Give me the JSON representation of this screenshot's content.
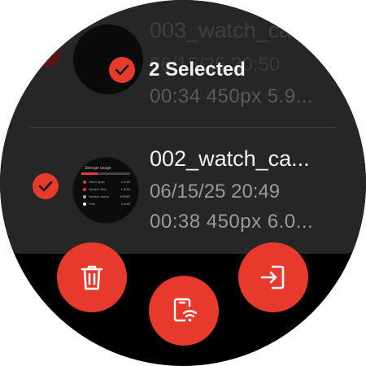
{
  "colors": {
    "accent": "#e8392d",
    "background": "#000000",
    "card": "#262626"
  },
  "ghost_row": {
    "file_name": "003_watch_ca...",
    "date": "06/15/25 20:50",
    "meta": "00:34  450px  5.9..."
  },
  "header": {
    "selected_label": "2 Selected",
    "icon": "check-icon"
  },
  "row": {
    "file_name": "002_watch_ca...",
    "date": "06/15/25 20:49",
    "meta": "00:38  450px  6.0...",
    "selected": true,
    "thumbnail": {
      "title": "Storage usage",
      "progress": 0.33,
      "lines": [
        {
          "label": "Other apps",
          "value": "2.5GB",
          "color": "#e8392d"
        },
        {
          "label": "System files",
          "value": "1.8GB",
          "color": "#e8392d"
        },
        {
          "label": "System cache",
          "value": "400MB",
          "color": "#aaaaaa"
        },
        {
          "label": "Free",
          "value": "4.4GB",
          "color": "#ffffff"
        }
      ]
    }
  },
  "actions": [
    {
      "name": "delete",
      "icon": "trash-icon"
    },
    {
      "name": "send-to-phone",
      "icon": "phone-wifi-icon"
    },
    {
      "name": "export",
      "icon": "export-icon"
    }
  ]
}
